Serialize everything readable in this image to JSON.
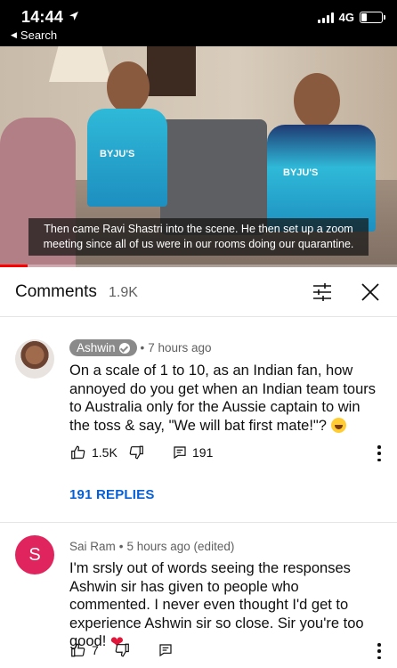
{
  "status_bar": {
    "time": "14:44",
    "back_label": "Search",
    "network": "4G",
    "battery_level": 0.25
  },
  "video": {
    "caption": "Then came Ravi Shastri into the scene. He then set up a zoom meeting since all of us were in our rooms doing our quarantine.",
    "jersey_brand": "BYJU'S",
    "progress": 0.07,
    "progress_color": "#ff0000"
  },
  "comments_panel": {
    "title": "Comments",
    "count": "1.9K"
  },
  "comments": [
    {
      "author": "Ashwin",
      "verified_creator": true,
      "time": "7 hours ago",
      "text": "On a scale of 1 to 10, as an Indian fan, how annoyed do you get when an Indian team tours to Australia only for the Aussie captain to win the toss & say, \"We will bat first mate!\"?",
      "likes": "1.5K",
      "replies_count": "191",
      "replies_link": "191 REPLIES"
    },
    {
      "author": "Sai Ram",
      "avatar_letter": "S",
      "avatar_color": "#e0245e",
      "time": "5 hours ago (edited)",
      "text": "I'm srsly out of words seeing the responses Ashwin sir has given to people who commented. I never even thought I'd get to experience Ashwin sir so close. Sir you're too good!",
      "likes": "7"
    }
  ],
  "colors": {
    "link_blue": "#065fd4",
    "secondary_text": "#606060",
    "author_badge": "#8a8a8a"
  }
}
